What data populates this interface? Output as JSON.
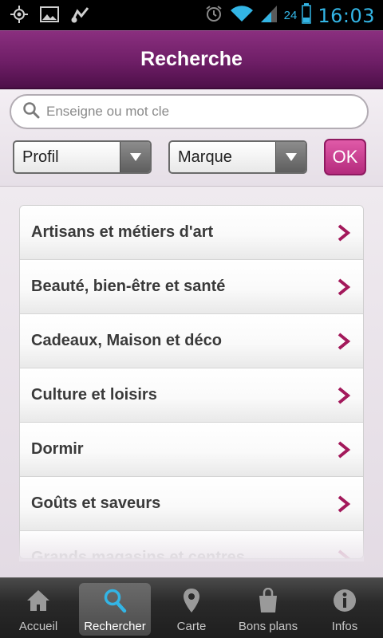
{
  "status_bar": {
    "left_icons": [
      "gps-icon",
      "image-icon",
      "music-icon"
    ],
    "right_icons": [
      "alarm-icon",
      "wifi-icon",
      "signal-icon"
    ],
    "battery": "24",
    "clock": "16:03"
  },
  "header": {
    "title": "Recherche"
  },
  "filters": {
    "search_placeholder": "Enseigne ou mot cle",
    "select_profil": "Profil",
    "select_marque": "Marque",
    "ok_label": "OK"
  },
  "categories": [
    "Artisans et métiers d'art",
    "Beauté, bien-être et santé",
    "Cadeaux, Maison et déco",
    "Culture et loisirs",
    "Dormir",
    "Goûts et saveurs",
    "Grands magasins et centres"
  ],
  "bottom_nav": [
    {
      "label": "Accueil",
      "icon": "home-icon"
    },
    {
      "label": "Rechercher",
      "icon": "search-icon",
      "active": true
    },
    {
      "label": "Carte",
      "icon": "map-pin-icon"
    },
    {
      "label": "Bons plans",
      "icon": "shopping-bag-icon"
    },
    {
      "label": "Infos",
      "icon": "info-icon"
    }
  ],
  "colors": {
    "header": "#6e1e66",
    "accent": "#c2357f",
    "status_text": "#33b5e5"
  }
}
